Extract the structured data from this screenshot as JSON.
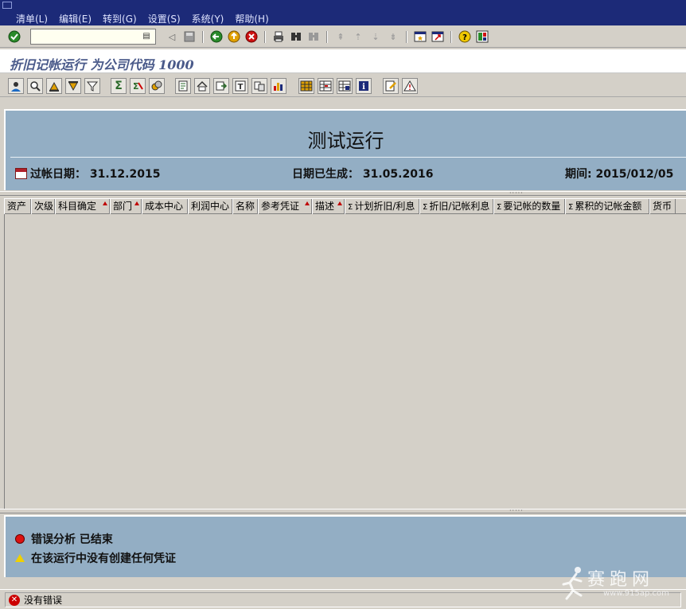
{
  "menu": {
    "items": [
      "清单(L)",
      "编辑(E)",
      "转到(G)",
      "设置(S)",
      "系统(Y)",
      "帮助(H)"
    ]
  },
  "toolbar": {
    "command_value": "",
    "icons": [
      "enter-icon",
      "back-icon",
      "exit-icon",
      "cancel-icon",
      "print-icon",
      "find-icon",
      "find-next-icon",
      "first-page-icon",
      "prev-page-icon",
      "next-page-icon",
      "last-page-icon",
      "new-session-icon",
      "shortcut-icon",
      "help-icon",
      "layout-icon"
    ]
  },
  "title": "折旧记帐运行 为公司代码 1000",
  "header": {
    "heading": "测试运行",
    "posting_date": "过帐日期： 31.12.2015",
    "generated_date": "日期已生成： 31.05.2016",
    "period": "期间: 2015/012/05"
  },
  "grid": {
    "columns": [
      {
        "label": "资产",
        "sum": false,
        "sorted": false
      },
      {
        "label": "次级",
        "sum": false,
        "sorted": false
      },
      {
        "label": "科目确定",
        "sum": false,
        "sorted": true
      },
      {
        "label": "部门",
        "sum": false,
        "sorted": true
      },
      {
        "label": "成本中心",
        "sum": false,
        "sorted": false
      },
      {
        "label": "利润中心",
        "sum": false,
        "sorted": false
      },
      {
        "label": "名称",
        "sum": false,
        "sorted": false
      },
      {
        "label": "参考凭证",
        "sum": false,
        "sorted": true
      },
      {
        "label": "描述",
        "sum": false,
        "sorted": true
      },
      {
        "label": "计划折旧/利息",
        "sum": true,
        "sorted": false
      },
      {
        "label": "折旧/记帐利息",
        "sum": true,
        "sorted": false
      },
      {
        "label": "要记帐的数量",
        "sum": true,
        "sorted": false
      },
      {
        "label": "累积的记帐金额",
        "sum": true,
        "sorted": false
      },
      {
        "label": "货币",
        "sum": false,
        "sorted": false
      }
    ],
    "sum_symbol": "Σ",
    "rows": []
  },
  "messages": [
    {
      "type": "error",
      "text": "错误分析 已结束"
    },
    {
      "type": "warning",
      "text": "在该运行中没有创建任何凭证"
    }
  ],
  "status": {
    "text": "没有错误",
    "error_symbol": "✕"
  },
  "watermark": {
    "brand": "赛跑网",
    "url": "www.915ap.com"
  },
  "colors": {
    "menubar": "#1c2a78",
    "header_bg": "#93aec4",
    "title_text": "#4a5a8a",
    "sort_marker": "#c00000"
  }
}
